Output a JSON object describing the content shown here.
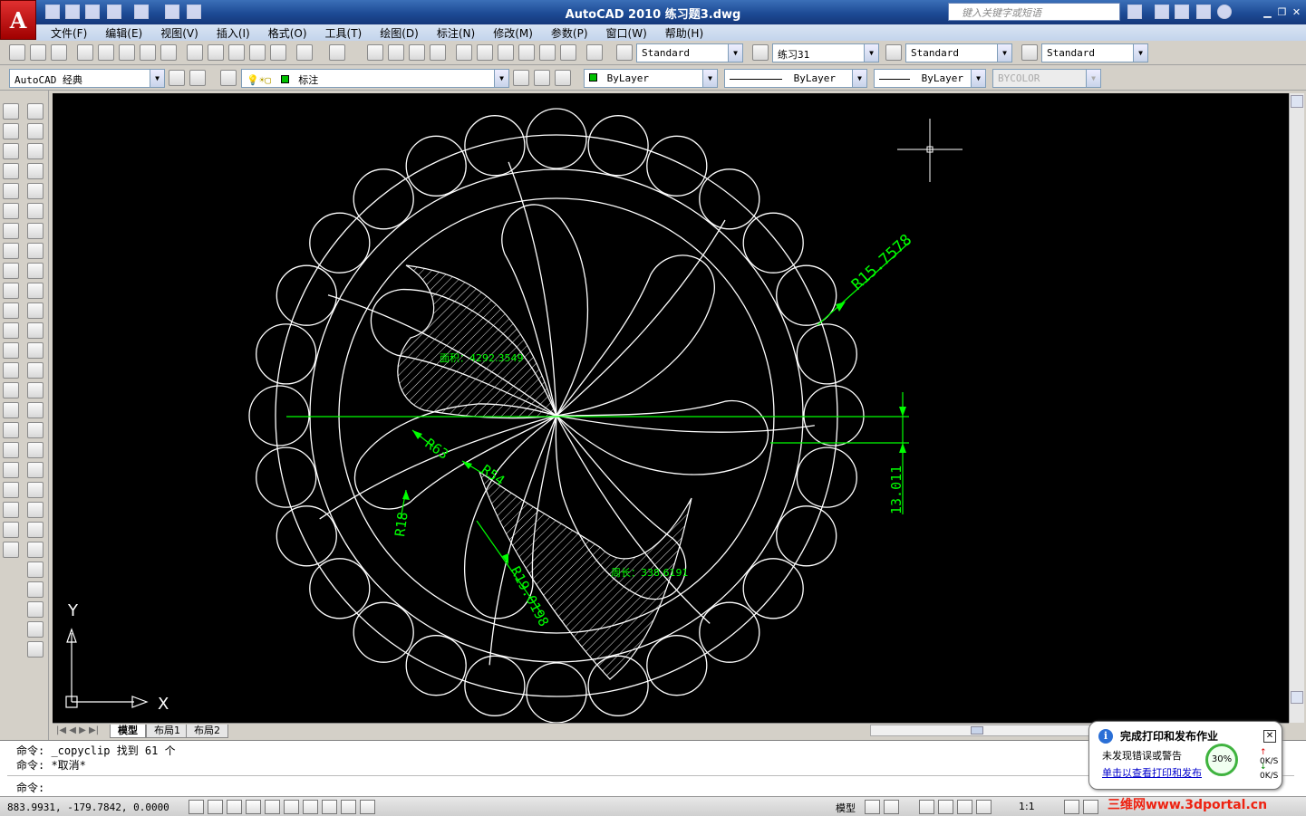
{
  "window": {
    "title": "AutoCAD 2010    练习题3.dwg",
    "search_placeholder": "键入关键字或短语",
    "logo_letter": "A"
  },
  "menu": [
    "文件(F)",
    "编辑(E)",
    "视图(V)",
    "插入(I)",
    "格式(O)",
    "工具(T)",
    "绘图(D)",
    "标注(N)",
    "修改(M)",
    "参数(P)",
    "窗口(W)",
    "帮助(H)"
  ],
  "toolbar": {
    "text_style": "Standard",
    "dim_style": "练习31",
    "table_style": "Standard",
    "multileader_style": "Standard",
    "workspace": "AutoCAD 经典",
    "layer": "标注",
    "color": "ByLayer",
    "linetype": "ByLayer",
    "lineweight": "ByLayer",
    "plot_style": "BYCOLOR"
  },
  "drawing": {
    "dims": {
      "r15": "R15.7578",
      "r63": "R63",
      "r54": "R54",
      "r18": "R18",
      "r19": "R19.0198",
      "h13": "13.011",
      "area": "面积：4292.3549",
      "perimeter": "周长：338.6191"
    },
    "ucs": {
      "x": "X",
      "y": "Y"
    },
    "colors": {
      "geometry": "#ffffff",
      "dimension": "#00ff00",
      "background": "#000000"
    }
  },
  "tabs": [
    "模型",
    "布局1",
    "布局2"
  ],
  "command": {
    "history": [
      "命令: _copyclip 找到 61 个",
      "命令: *取消*"
    ],
    "prompt": "命令:"
  },
  "status": {
    "coords": "883.9931, -179.7842, 0.0000",
    "model_label": "模型",
    "scale_label": "1:1"
  },
  "notification": {
    "title": "完成打印和发布作业",
    "message": "未发现错误或警告",
    "link": "单击以查看打印和发布",
    "gauge": "30%",
    "up": "0K/S",
    "down": "0K/S"
  },
  "watermark": "三维网www.3dportal.cn"
}
